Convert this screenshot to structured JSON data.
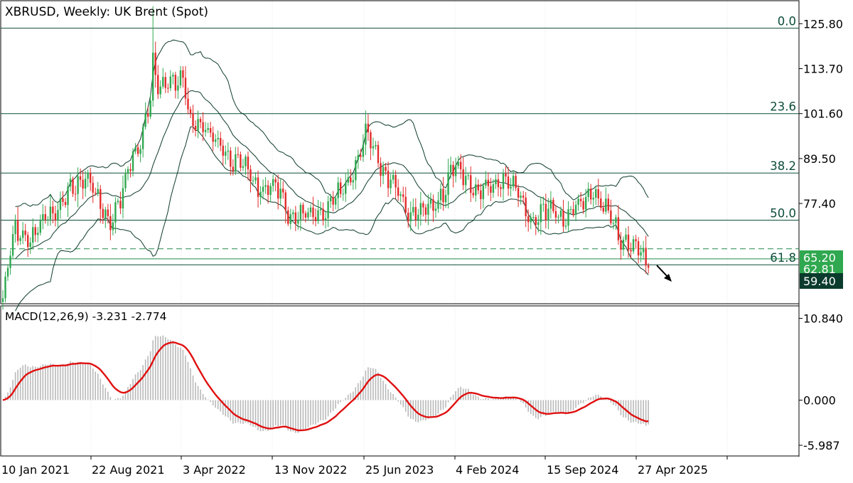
{
  "colors": {
    "background": "#ffffff",
    "frame": "#000000",
    "bull": "#2fa84f",
    "bear": "#e32b2b",
    "wick": "#4a4a4a",
    "bands": "#0d3b2a",
    "fib_line": "#0d4d3a",
    "fib_text": "#0d4d3a",
    "histogram": "#b9b9b9",
    "signal": "#e01010",
    "bid_bg": "#2fa84f",
    "last_bg": "#0b3b2c",
    "axis_text": "#000000"
  },
  "chart_data": [
    {
      "type": "candlestick",
      "title": "XBRUSD, Weekly:  UK Brent (Spot)",
      "ylim": [
        50.6,
        131.8
      ],
      "y_ticks": [
        125.8,
        113.7,
        101.6,
        89.5,
        77.4
      ],
      "x_tick_labels": [
        "10 Jan 2021",
        "22 Aug 2021",
        "3 Apr 2022",
        "13 Nov 2022",
        "25 Jun 2023",
        "4 Feb 2024",
        "15 Sep 2024",
        "27 Apr 2025"
      ],
      "fibonacci": [
        {
          "level": "0.0",
          "price": 124.6
        },
        {
          "level": "23.6",
          "price": 101.6
        },
        {
          "level": "38.2",
          "price": 85.6
        },
        {
          "level": "50.0",
          "price": 72.9
        },
        {
          "level": "61.8",
          "price": 60.9
        }
      ],
      "horizontal_lines": [
        {
          "price": 65.2,
          "style": "dashed"
        },
        {
          "price": 62.5,
          "style": "solid"
        }
      ],
      "price_labels": {
        "bid": "65.20",
        "hidden": "62.81",
        "last": "59.40"
      },
      "bollinger_bands": true,
      "arrow": "down",
      "anchors": [
        [
          0,
          51.5
        ],
        [
          5,
          70
        ],
        [
          12,
          68
        ],
        [
          20,
          76
        ],
        [
          28,
          80
        ],
        [
          33,
          87
        ],
        [
          38,
          77
        ],
        [
          42,
          72
        ],
        [
          48,
          81
        ],
        [
          55,
          95
        ],
        [
          60,
          110
        ],
        [
          62,
          107
        ],
        [
          67,
          112
        ],
        [
          72,
          110
        ],
        [
          75,
          98
        ],
        [
          80,
          100
        ],
        [
          85,
          93
        ],
        [
          90,
          90
        ],
        [
          95,
          89
        ],
        [
          100,
          82
        ],
        [
          105,
          83
        ],
        [
          110,
          80
        ],
        [
          115,
          75
        ],
        [
          120,
          73
        ],
        [
          125,
          75
        ],
        [
          130,
          76
        ],
        [
          135,
          80
        ],
        [
          140,
          87
        ],
        [
          145,
          95
        ],
        [
          150,
          90
        ],
        [
          155,
          83
        ],
        [
          160,
          78
        ],
        [
          165,
          75
        ],
        [
          170,
          75
        ],
        [
          175,
          80
        ],
        [
          180,
          86
        ],
        [
          185,
          85
        ],
        [
          190,
          80
        ],
        [
          195,
          82
        ],
        [
          200,
          85
        ],
        [
          205,
          80
        ],
        [
          210,
          75
        ],
        [
          215,
          73
        ],
        [
          220,
          77
        ],
        [
          225,
          72
        ],
        [
          230,
          76
        ],
        [
          235,
          82
        ],
        [
          240,
          75
        ],
        [
          245,
          72
        ],
        [
          250,
          65
        ],
        [
          255,
          64
        ],
        [
          258,
          63
        ]
      ]
    },
    {
      "type": "macd",
      "label": "MACD(12,26,9) -3.231 -2.774",
      "ylim": [
        -7.4,
        12.4
      ],
      "y_ticks": [
        "10.840",
        "0.000",
        "-5.987"
      ],
      "y_tick_values": [
        10.84,
        0.0,
        -5.987
      ],
      "macd_last": -3.231,
      "signal_last": -2.774
    }
  ]
}
